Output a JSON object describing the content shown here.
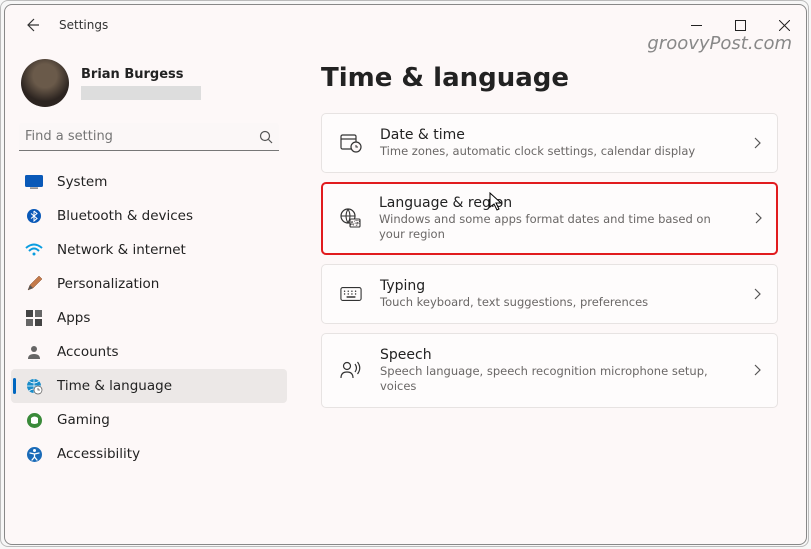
{
  "watermark": "groovyPost.com",
  "window_title": "Settings",
  "user": {
    "name": "Brian Burgess"
  },
  "search": {
    "placeholder": "Find a setting"
  },
  "nav": {
    "items": [
      {
        "label": "System"
      },
      {
        "label": "Bluetooth & devices"
      },
      {
        "label": "Network & internet"
      },
      {
        "label": "Personalization"
      },
      {
        "label": "Apps"
      },
      {
        "label": "Accounts"
      },
      {
        "label": "Time & language"
      },
      {
        "label": "Gaming"
      },
      {
        "label": "Accessibility"
      }
    ]
  },
  "page": {
    "title": "Time & language"
  },
  "cards": [
    {
      "title": "Date & time",
      "desc": "Time zones, automatic clock settings, calendar display"
    },
    {
      "title": "Language & region",
      "desc": "Windows and some apps format dates and time based on your region"
    },
    {
      "title": "Typing",
      "desc": "Touch keyboard, text suggestions, preferences"
    },
    {
      "title": "Speech",
      "desc": "Speech language, speech recognition microphone setup, voices"
    }
  ]
}
